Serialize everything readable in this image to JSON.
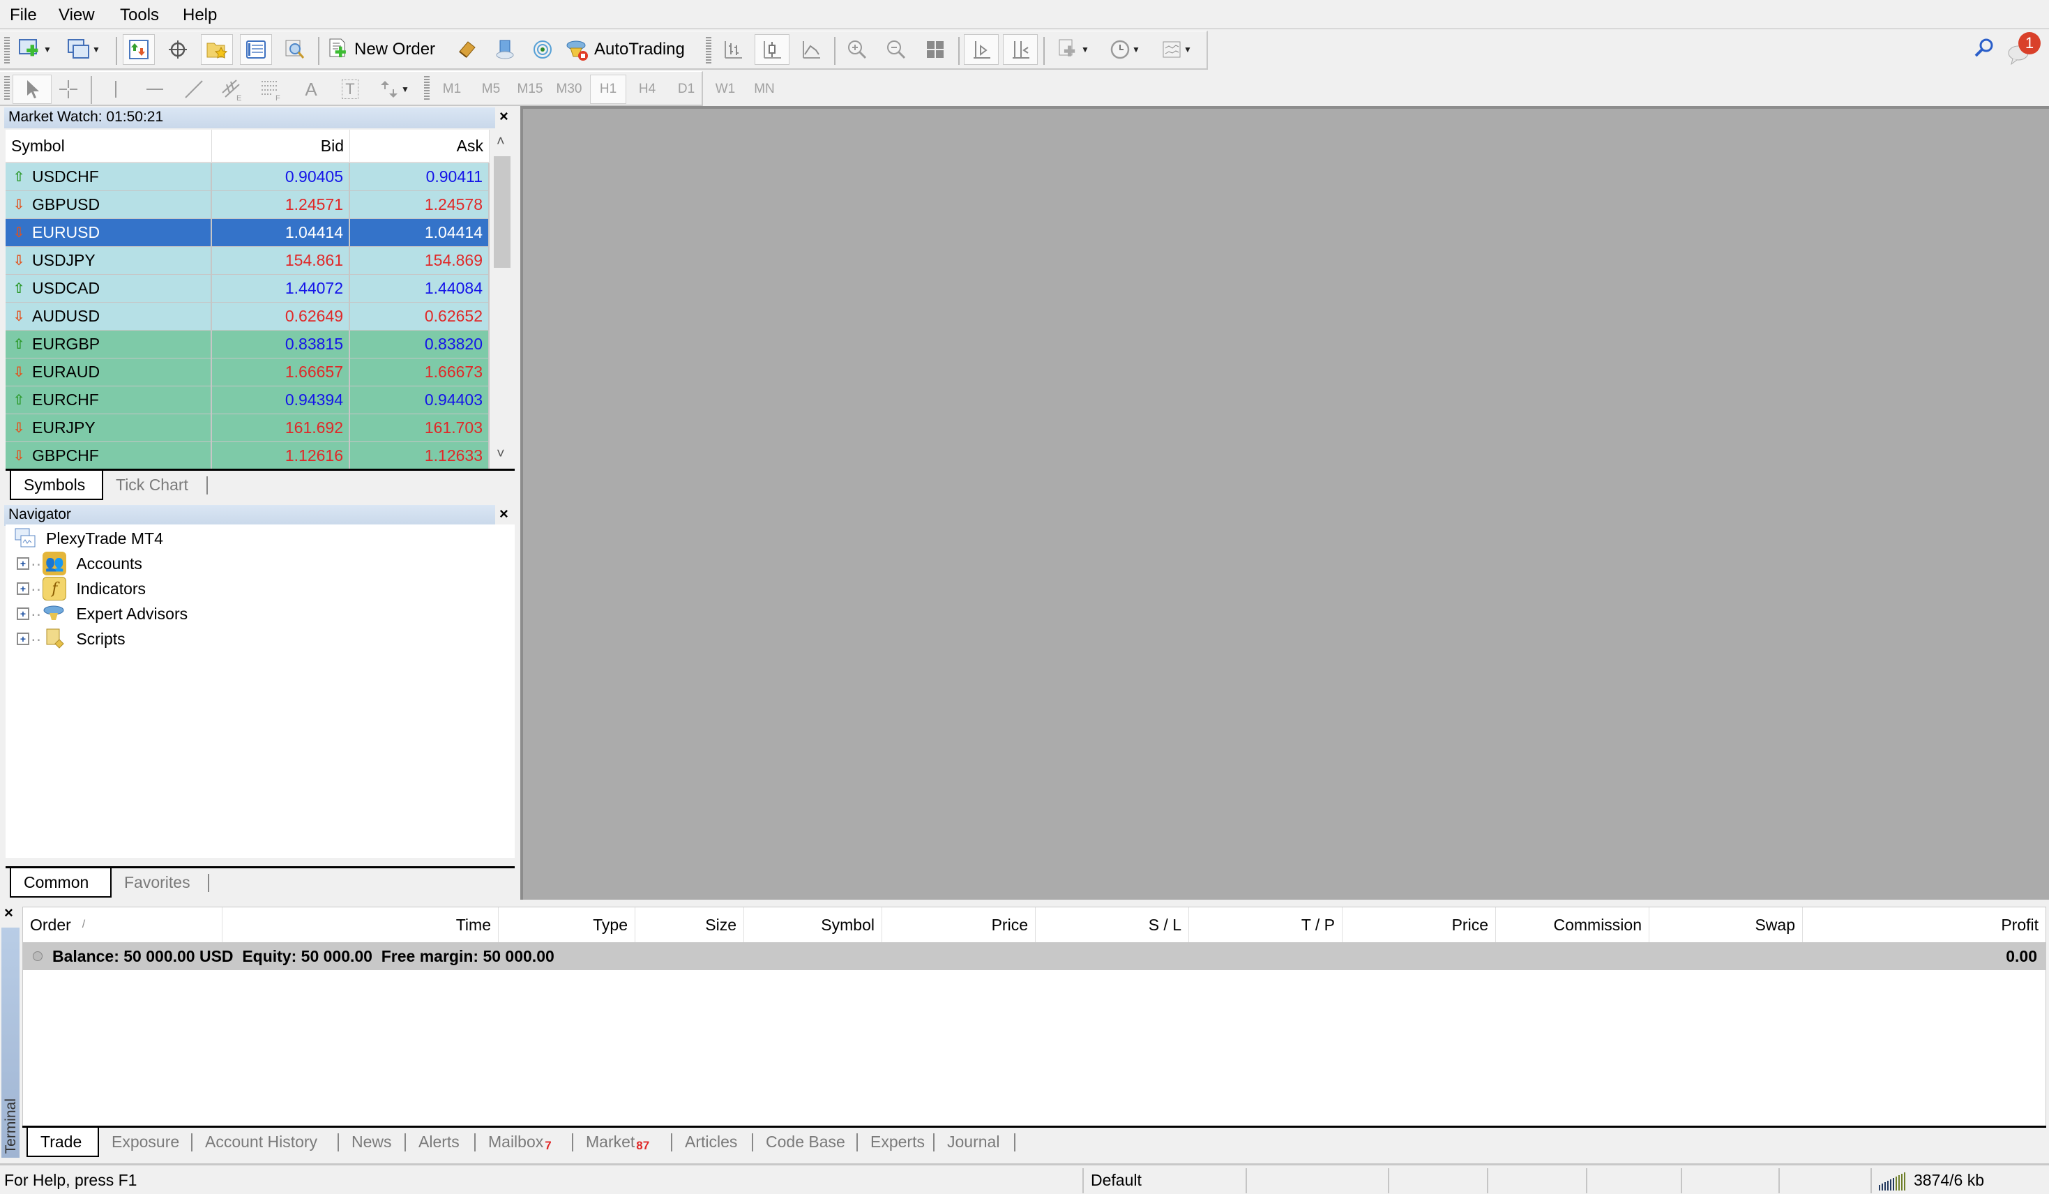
{
  "menu": [
    "File",
    "View",
    "Tools",
    "Help"
  ],
  "toolbar": {
    "new_order_label": "New Order",
    "autotrading_label": "AutoTrading",
    "icons": [
      "new-chart-icon",
      "profiles-icon",
      "market-watch-icon",
      "data-window-icon",
      "navigator-icon",
      "terminal-icon",
      "strategy-tester-icon",
      "new-order-icon",
      "metaeditor-icon",
      "signals-icon",
      "vps-icon",
      "autotrading-icon",
      "bar-chart-icon",
      "candlesticks-icon",
      "line-chart-icon",
      "zoom-in-icon",
      "zoom-out-icon",
      "tile-windows-icon",
      "chart-shift-icon",
      "autoscroll-icon",
      "indicators-icon",
      "periods-icon",
      "templates-icon"
    ],
    "search_icon": "search-icon",
    "notification_count": "1"
  },
  "drawing_toolbar": {
    "tools": [
      "cursor",
      "crosshair",
      "vertical-line",
      "horizontal-line",
      "trendline",
      "equidistant-channel",
      "fibonacci",
      "text",
      "text-label",
      "arrows"
    ],
    "text_glyph": "A",
    "label_glyph": "T",
    "timeframes": [
      "M1",
      "M5",
      "M15",
      "M30",
      "H1",
      "H4",
      "D1",
      "W1",
      "MN"
    ],
    "active_timeframe": "H1"
  },
  "market_watch": {
    "title": "Market Watch: 01:50:21",
    "columns": [
      "Symbol",
      "Bid",
      "Ask"
    ],
    "rows": [
      {
        "symbol": "USDCHF",
        "bid": "0.90405",
        "ask": "0.90411",
        "dir": "up",
        "group": "light"
      },
      {
        "symbol": "GBPUSD",
        "bid": "1.24571",
        "ask": "1.24578",
        "dir": "down",
        "group": "light"
      },
      {
        "symbol": "EURUSD",
        "bid": "1.04414",
        "ask": "1.04414",
        "dir": "down",
        "group": "sel"
      },
      {
        "symbol": "USDJPY",
        "bid": "154.861",
        "ask": "154.869",
        "dir": "down",
        "group": "light"
      },
      {
        "symbol": "USDCAD",
        "bid": "1.44072",
        "ask": "1.44084",
        "dir": "up",
        "group": "light"
      },
      {
        "symbol": "AUDUSD",
        "bid": "0.62649",
        "ask": "0.62652",
        "dir": "down",
        "group": "light"
      },
      {
        "symbol": "EURGBP",
        "bid": "0.83815",
        "ask": "0.83820",
        "dir": "up",
        "group": "green"
      },
      {
        "symbol": "EURAUD",
        "bid": "1.66657",
        "ask": "1.66673",
        "dir": "down",
        "group": "green"
      },
      {
        "symbol": "EURCHF",
        "bid": "0.94394",
        "ask": "0.94403",
        "dir": "up",
        "group": "green"
      },
      {
        "symbol": "EURJPY",
        "bid": "161.692",
        "ask": "161.703",
        "dir": "down",
        "group": "green"
      },
      {
        "symbol": "GBPCHF",
        "bid": "1.12616",
        "ask": "1.12633",
        "dir": "down",
        "group": "green"
      }
    ],
    "tabs": [
      "Symbols",
      "Tick Chart"
    ],
    "active_tab": "Symbols"
  },
  "navigator": {
    "title": "Navigator",
    "root": "PlexyTrade MT4",
    "items": [
      "Accounts",
      "Indicators",
      "Expert Advisors",
      "Scripts"
    ],
    "tabs": [
      "Common",
      "Favorites"
    ],
    "active_tab": "Common"
  },
  "terminal": {
    "side_label": "Terminal",
    "columns": [
      "Order",
      "Time",
      "Type",
      "Size",
      "Symbol",
      "Price",
      "S / L",
      "T / P",
      "Price",
      "Commission",
      "Swap",
      "Profit"
    ],
    "sort_indicator": "/",
    "balance_text": "Balance: 50 000.00 USD  Equity: 50 000.00  Free margin: 50 000.00",
    "profit_total": "0.00",
    "tabs": [
      {
        "label": "Trade",
        "badge": ""
      },
      {
        "label": "Exposure",
        "badge": ""
      },
      {
        "label": "Account History",
        "badge": ""
      },
      {
        "label": "News",
        "badge": ""
      },
      {
        "label": "Alerts",
        "badge": ""
      },
      {
        "label": "Mailbox",
        "badge": "7"
      },
      {
        "label": "Market",
        "badge": "87"
      },
      {
        "label": "Articles",
        "badge": ""
      },
      {
        "label": "Code Base",
        "badge": ""
      },
      {
        "label": "Experts",
        "badge": ""
      },
      {
        "label": "Journal",
        "badge": ""
      }
    ],
    "active_tab": "Trade"
  },
  "status_bar": {
    "help": "For Help, press F1",
    "profile": "Default",
    "connection": "3874/6 kb"
  },
  "colors": {
    "bid_up": "#1414e8",
    "bid_down": "#e02828",
    "selected_row": "#3473c9",
    "row_light": "#b6e0e6",
    "row_green": "#7ecaa8",
    "chart_bg": "#ababab",
    "badge": "#e02828"
  }
}
